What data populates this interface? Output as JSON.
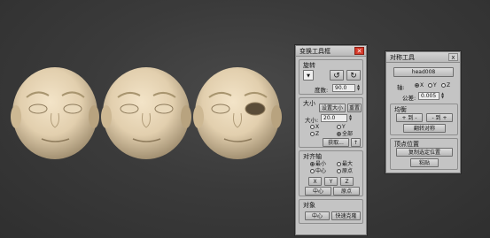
{
  "transform_panel": {
    "title": "变换工具框",
    "close": "✕",
    "rotate": {
      "label": "旋转",
      "degree_label": "度数:",
      "degree_value": "90.0"
    },
    "size": {
      "label": "大小",
      "set_size": "设置大小",
      "reset": "重置",
      "size_label": "大小:",
      "size_value": "20.0",
      "x": "X",
      "y": "Y",
      "z": "Z",
      "all": "全部",
      "get": "获取...",
      "up": "↑"
    },
    "align": {
      "label": "对齐轴",
      "min": "最小",
      "max": "最大",
      "center": "中心",
      "origin": "原点",
      "x": "X",
      "y": "Y",
      "z": "Z",
      "center_btn": "中心",
      "origin_btn": "原点"
    },
    "object": {
      "label": "对象",
      "center_btn": "中心",
      "quick_clone": "快速克隆"
    }
  },
  "mirror_panel": {
    "title": "对称工具",
    "close": "x",
    "object_name": "head008",
    "axis_label": "轴:",
    "axis_x": "X",
    "axis_y": "Y",
    "axis_z": "Z",
    "tolerance_label": "公差:",
    "tolerance_value": "0.005",
    "balance": {
      "label": "均衡",
      "plus_to": "+ 到 -",
      "minus_to": "- 到 +",
      "flip": "翻转对称"
    },
    "vertex": {
      "label": "顶点位置",
      "copy": "复制选定位置",
      "paste": "粘贴"
    }
  }
}
